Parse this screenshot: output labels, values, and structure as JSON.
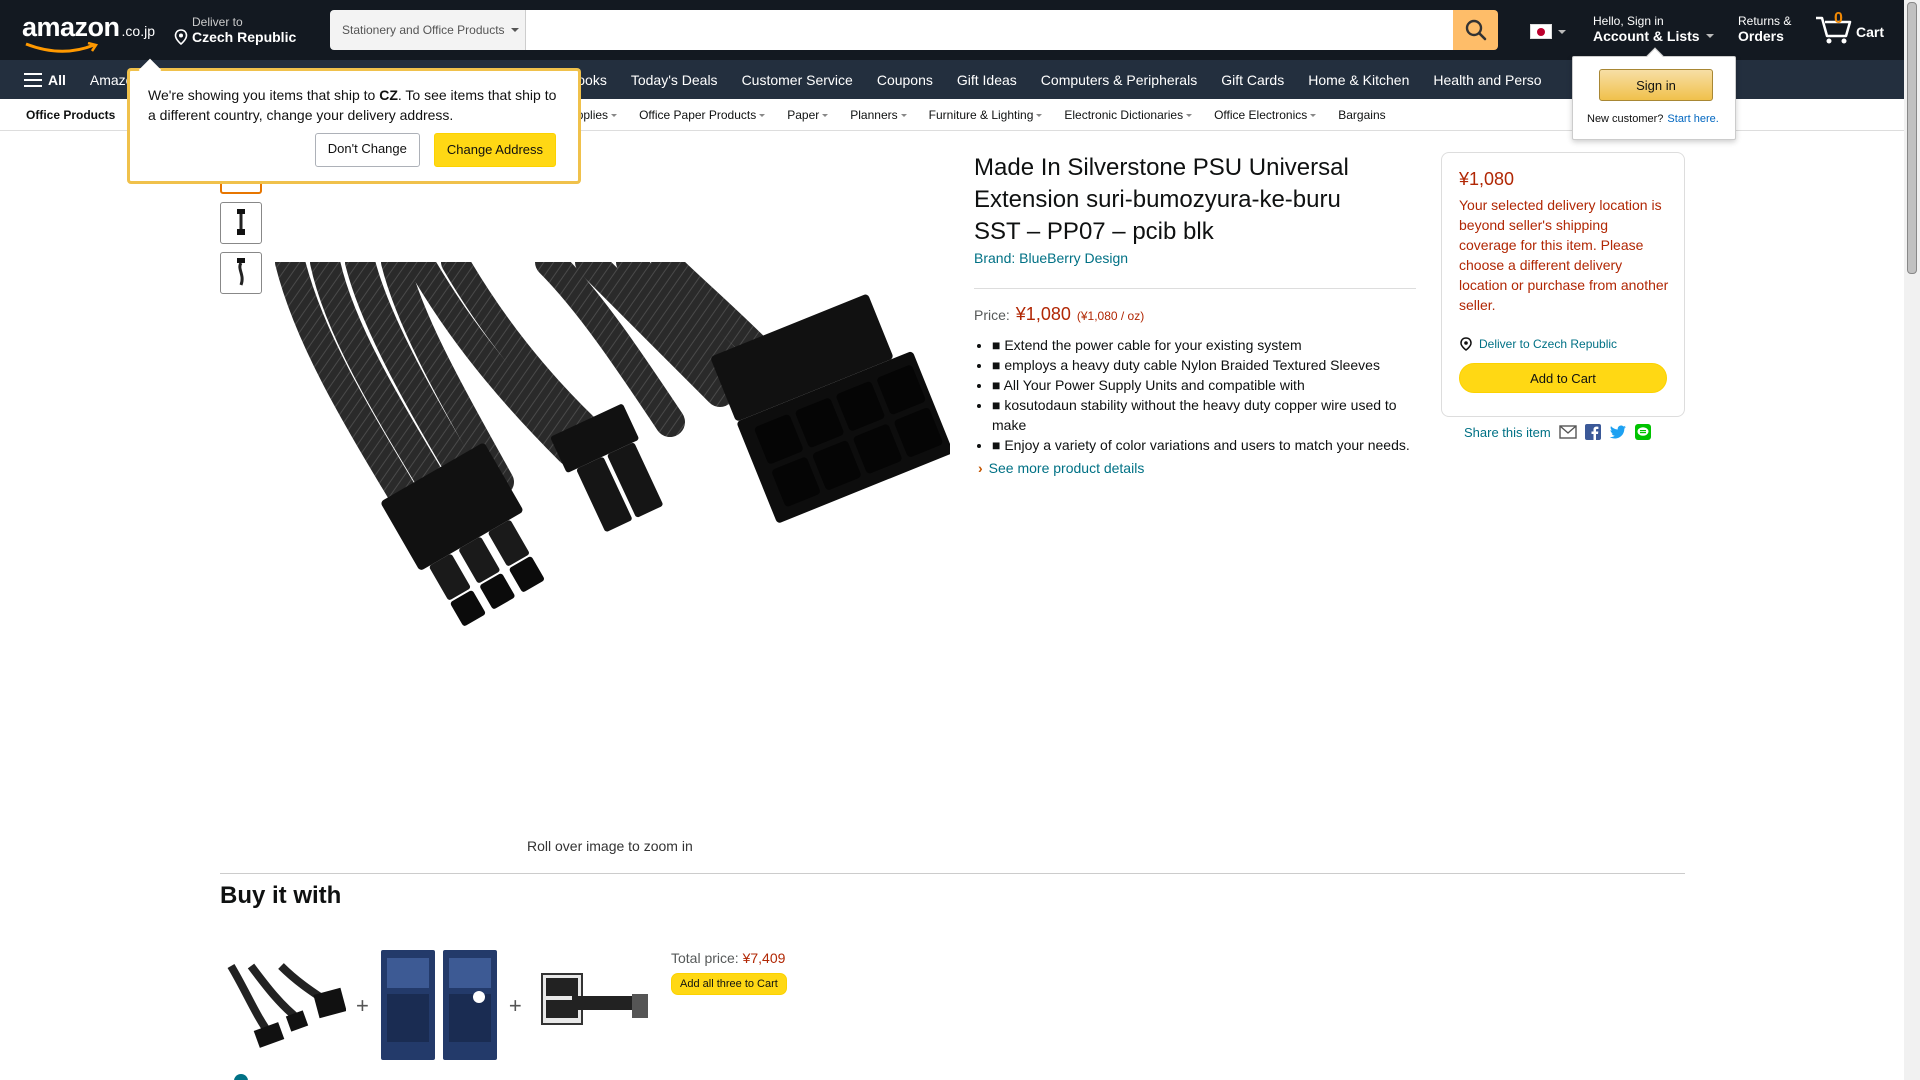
{
  "header": {
    "logo_text": "amazon",
    "logo_tld": ".co.jp",
    "deliver_line1": "Deliver to",
    "deliver_line2": "Czech Republic",
    "search_category": "Stationery and Office Products",
    "search_value": "",
    "account_line1": "Hello, Sign in",
    "account_line2": "Account & Lists",
    "returns_line1": "Returns &",
    "returns_line2": "Orders",
    "cart_count": "0",
    "cart_label": "Cart"
  },
  "nav_main": {
    "all_label": "All",
    "items": [
      "Amazon",
      "se Books",
      "Today's Deals",
      "Customer Service",
      "Coupons",
      "Gift Ideas",
      "Computers & Peripherals",
      "Gift Cards",
      "Home & Kitchen",
      "Health and Perso"
    ]
  },
  "nav_sub": {
    "first": "Office Products",
    "items": [
      ", Supplies",
      "Office Paper Products",
      "Paper",
      "Planners",
      "Furniture & Lighting",
      "Electronic Dictionaries",
      "Office Electronics",
      "Bargains"
    ]
  },
  "popover": {
    "text_before": "We're showing you items that ship to ",
    "country_code": "CZ",
    "text_after": ". To see items that ship to a different country, change your delivery address.",
    "dont_change": "Don't Change",
    "change_address": "Change Address"
  },
  "signin_flyout": {
    "button": "Sign in",
    "new_customer": "New customer?",
    "start_here": "Start here."
  },
  "product": {
    "title": "Made In Silverstone PSU Universal Extension suri-bumozyura-ke-buru SST – PP07 – pcib blk",
    "brand": "Brand: BlueBerry Design",
    "price_label": "Price:",
    "price": "¥1,080",
    "unit_price": "(¥1,080 / oz)",
    "bullets": [
      "■ Extend the power cable for your existing system",
      "■ employs a heavy duty cable Nylon Braided Textured Sleeves",
      "■ All Your Power Supply Units and compatible with",
      "■ kosutodaun stability without the heavy duty copper wire used to make",
      "■ Enjoy a variety of color variations and users to match your needs."
    ],
    "see_more": "See more product details",
    "zoom_hint": "Roll over image to zoom in"
  },
  "buybox": {
    "price": "¥1,080",
    "warning": "Your selected delivery location is beyond seller's shipping coverage for this item. Please choose a different delivery location or purchase from another seller.",
    "deliver_to": "Deliver to Czech Republic",
    "add_to_cart": "Add to Cart",
    "share_label": "Share this item"
  },
  "buy_it_with": {
    "title": "Buy it with",
    "total_label": "Total price:",
    "total_price": "¥7,409",
    "add_all": "Add all three to Cart"
  },
  "colors": {
    "nav_dark": "#131921",
    "nav_secondary": "#232f3e",
    "price_red": "#b12704",
    "link_teal": "#007185",
    "button_yellow": "#ffd814",
    "search_orange": "#febd69"
  }
}
